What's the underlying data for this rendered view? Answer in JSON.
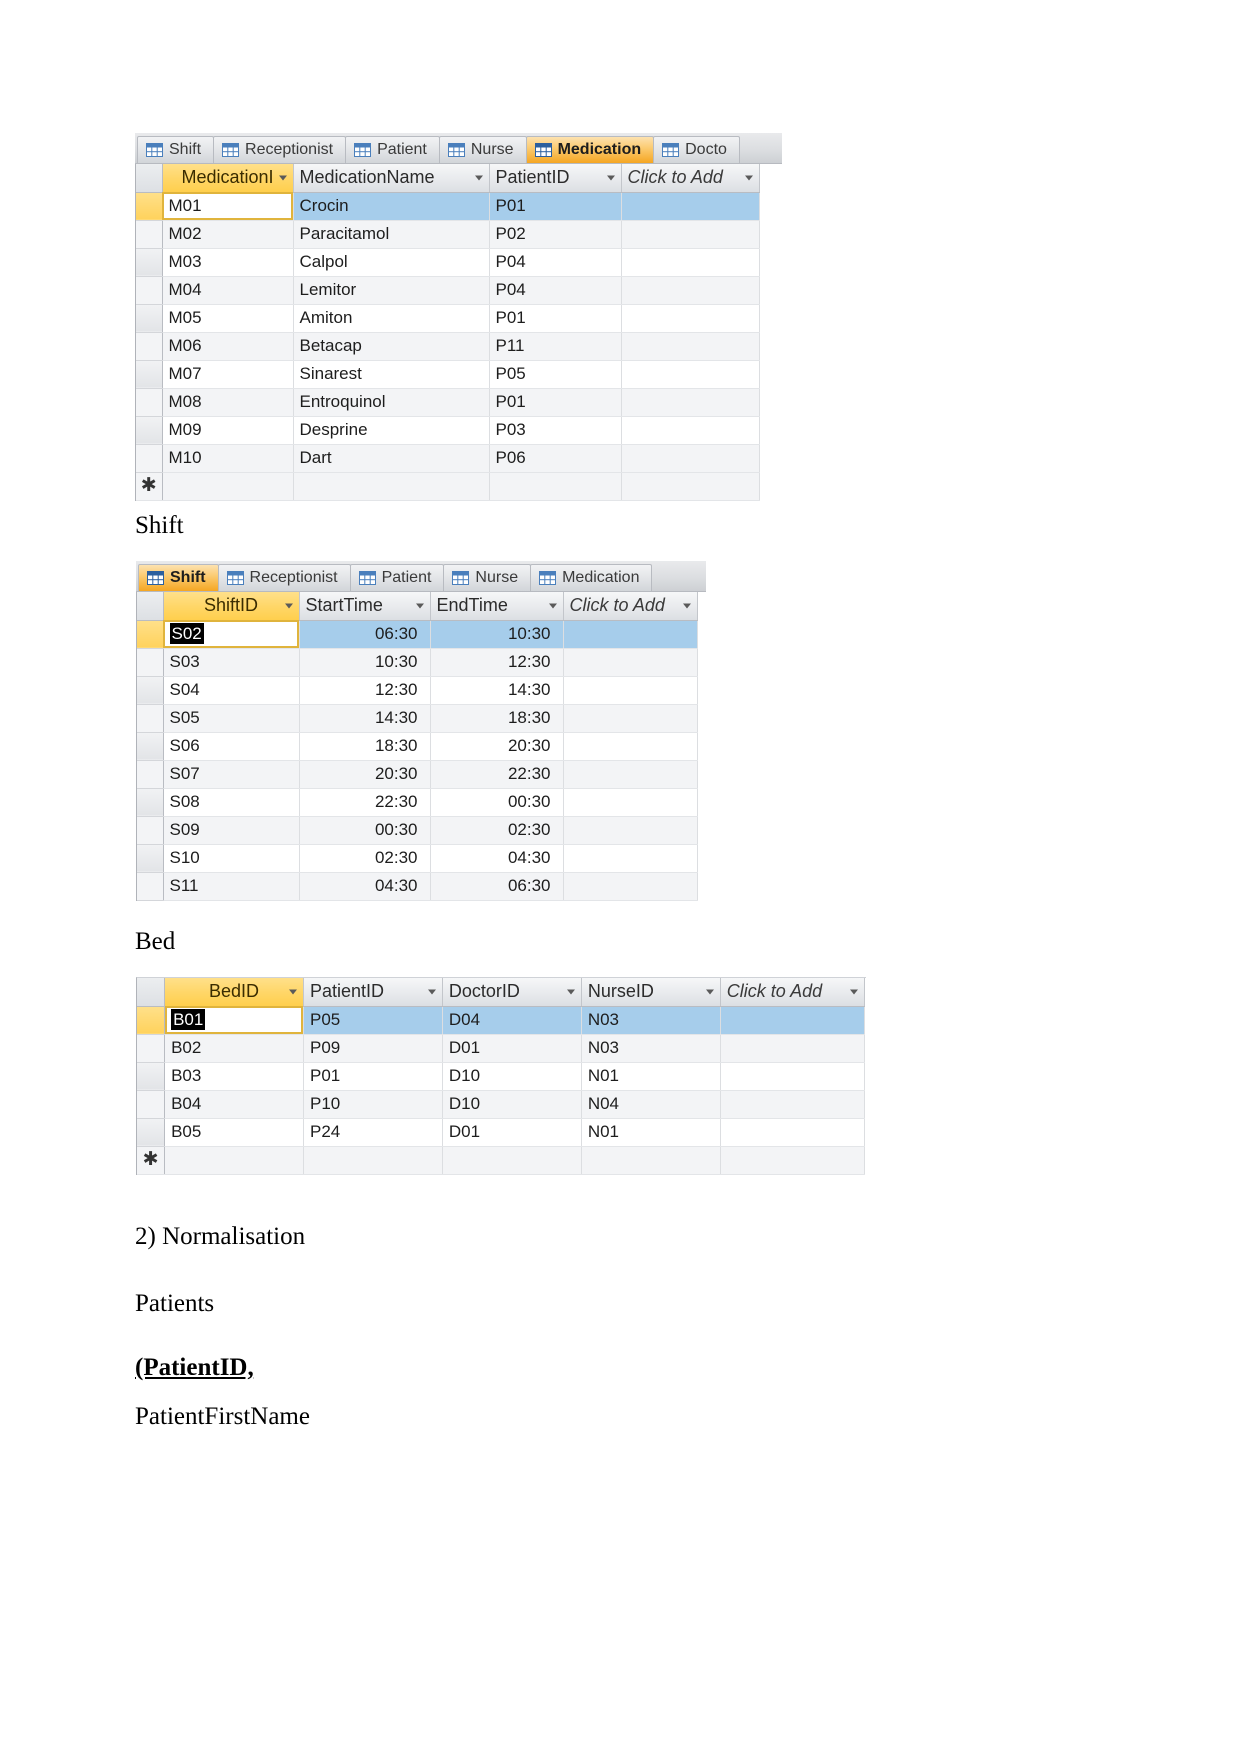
{
  "document": {
    "labels": {
      "shift_heading": "Shift",
      "bed_heading": "Bed",
      "normalisation_heading": "2) Normalisation",
      "patients_heading": "Patients",
      "patient_id_line": "(PatientID,",
      "patient_first_name": "PatientFirstName"
    }
  },
  "medication_screenshot": {
    "tabs": [
      {
        "label": "Shift",
        "active": false
      },
      {
        "label": "Receptionist",
        "active": false
      },
      {
        "label": "Patient",
        "active": false
      },
      {
        "label": "Nurse",
        "active": false
      },
      {
        "label": "Medication",
        "active": true
      },
      {
        "label": "Docto",
        "active": false
      }
    ],
    "columns": [
      {
        "label": "MedicationI",
        "key": true
      },
      {
        "label": "MedicationName",
        "key": false
      },
      {
        "label": "PatientID",
        "key": false
      },
      {
        "label": "Click to Add",
        "key": false,
        "addnew": true
      }
    ],
    "rows": [
      {
        "cells": [
          "M01",
          "Crocin",
          "P01",
          ""
        ],
        "selected": true,
        "current_cell": 0
      },
      {
        "cells": [
          "M02",
          "Paracitamol",
          "P02",
          ""
        ],
        "selected": false
      },
      {
        "cells": [
          "M03",
          "Calpol",
          "P04",
          ""
        ],
        "selected": false
      },
      {
        "cells": [
          "M04",
          "Lemitor",
          "P04",
          ""
        ],
        "selected": false
      },
      {
        "cells": [
          "M05",
          "Amiton",
          "P01",
          ""
        ],
        "selected": false
      },
      {
        "cells": [
          "M06",
          "Betacap",
          "P11",
          ""
        ],
        "selected": false
      },
      {
        "cells": [
          "M07",
          "Sinarest",
          "P05",
          ""
        ],
        "selected": false
      },
      {
        "cells": [
          "M08",
          "Entroquinol",
          "P01",
          ""
        ],
        "selected": false
      },
      {
        "cells": [
          "M09",
          "Desprine",
          "P03",
          ""
        ],
        "selected": false
      },
      {
        "cells": [
          "M10",
          "Dart",
          "P06",
          ""
        ],
        "selected": false
      }
    ],
    "new_row_marker": "✱"
  },
  "shift_screenshot": {
    "tabs": [
      {
        "label": "Shift",
        "active": true
      },
      {
        "label": "Receptionist",
        "active": false
      },
      {
        "label": "Patient",
        "active": false
      },
      {
        "label": "Nurse",
        "active": false
      },
      {
        "label": "Medication",
        "active": false
      }
    ],
    "columns": [
      {
        "label": "ShiftID",
        "key": true
      },
      {
        "label": "StartTime",
        "key": false
      },
      {
        "label": "EndTime",
        "key": false
      },
      {
        "label": "Click to Add",
        "key": false,
        "addnew": true
      }
    ],
    "rows": [
      {
        "cells": [
          "S02",
          "06:30",
          "10:30",
          ""
        ],
        "selected": true,
        "current_cell": 0,
        "editing_text": "S02"
      },
      {
        "cells": [
          "S03",
          "10:30",
          "12:30",
          ""
        ],
        "selected": false
      },
      {
        "cells": [
          "S04",
          "12:30",
          "14:30",
          ""
        ],
        "selected": false
      },
      {
        "cells": [
          "S05",
          "14:30",
          "18:30",
          ""
        ],
        "selected": false
      },
      {
        "cells": [
          "S06",
          "18:30",
          "20:30",
          ""
        ],
        "selected": false
      },
      {
        "cells": [
          "S07",
          "20:30",
          "22:30",
          ""
        ],
        "selected": false
      },
      {
        "cells": [
          "S08",
          "22:30",
          "00:30",
          ""
        ],
        "selected": false
      },
      {
        "cells": [
          "S09",
          "00:30",
          "02:30",
          ""
        ],
        "selected": false
      },
      {
        "cells": [
          "S10",
          "02:30",
          "04:30",
          ""
        ],
        "selected": false
      },
      {
        "cells": [
          "S11",
          "04:30",
          "06:30",
          ""
        ],
        "selected": false
      }
    ]
  },
  "bed_screenshot": {
    "columns": [
      {
        "label": "BedID",
        "key": true
      },
      {
        "label": "PatientID",
        "key": false
      },
      {
        "label": "DoctorID",
        "key": false
      },
      {
        "label": "NurseID",
        "key": false
      },
      {
        "label": "Click to Add",
        "key": false,
        "addnew": true
      }
    ],
    "rows": [
      {
        "cells": [
          "B01",
          "P05",
          "D04",
          "N03",
          ""
        ],
        "selected": true,
        "current_cell": 0,
        "editing_text": "B01"
      },
      {
        "cells": [
          "B02",
          "P09",
          "D01",
          "N03",
          ""
        ],
        "selected": false
      },
      {
        "cells": [
          "B03",
          "P01",
          "D10",
          "N01",
          ""
        ],
        "selected": false
      },
      {
        "cells": [
          "B04",
          "P10",
          "D10",
          "N04",
          ""
        ],
        "selected": false
      },
      {
        "cells": [
          "B05",
          "P24",
          "D01",
          "N01",
          ""
        ],
        "selected": false
      }
    ],
    "new_row_marker": "✱"
  },
  "colors": {
    "key_header": "#ffd666",
    "selection_row": "#a6cdeb",
    "active_tab": "#f5a623"
  }
}
